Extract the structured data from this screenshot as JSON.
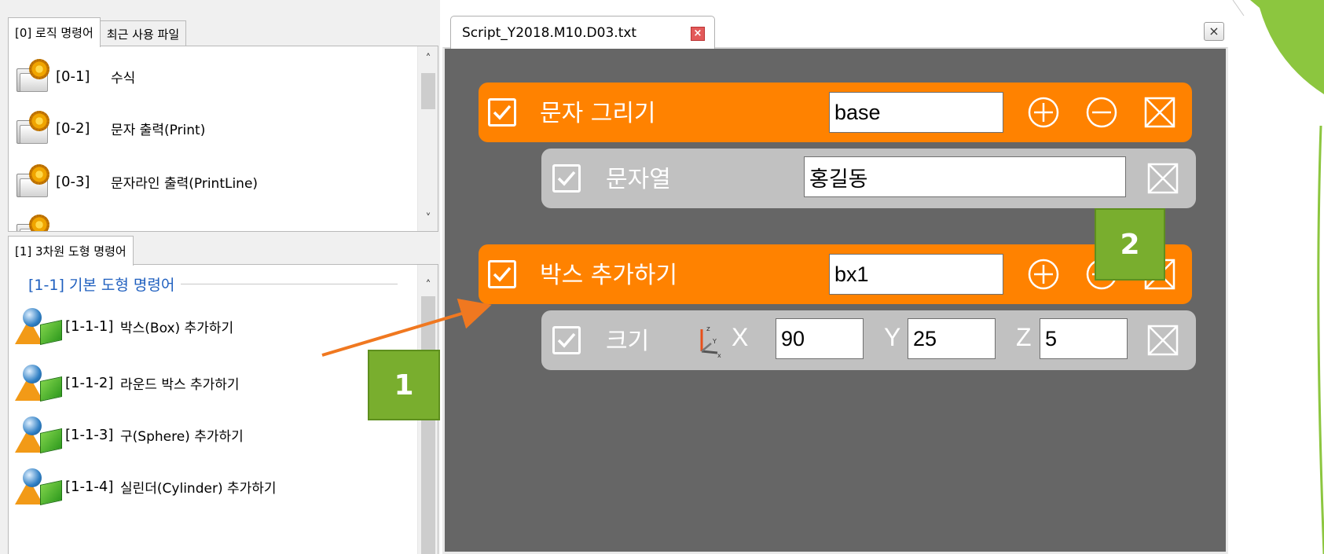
{
  "left_panel": {
    "top_tabs": [
      {
        "label": "[0] 로직 명령어",
        "active": true
      },
      {
        "label": "최근 사용 파일",
        "active": false
      }
    ],
    "logic_items": [
      {
        "code": "[0-1]",
        "label": "수식",
        "icon": "gear-folder-icon"
      },
      {
        "code": "[0-2]",
        "label": "문자 출력(Print)",
        "icon": "gear-folder-icon"
      },
      {
        "code": "[0-3]",
        "label": "문자라인 출력(PrintLine)",
        "icon": "gear-folder-icon"
      }
    ],
    "bottom_tabs": [
      {
        "label": "[1] 3차원 도형 명령어",
        "active": true
      }
    ],
    "section_header": "[1-1]  기본 도형 명령어",
    "shape_items": [
      {
        "code": "[1-1-1]",
        "label": "박스(Box) 추가하기",
        "icon": "shapes-icon"
      },
      {
        "code": "[1-1-2]",
        "label": "라운드 박스 추가하기",
        "icon": "shapes-icon"
      },
      {
        "code": "[1-1-3]",
        "label": "구(Sphere) 추가하기",
        "icon": "shapes-icon"
      },
      {
        "code": "[1-1-4]",
        "label": "실린더(Cylinder) 추가하기",
        "icon": "shapes-icon"
      }
    ]
  },
  "editor": {
    "tab_label": "Script_Y2018.M10.D03.txt",
    "window_close": "×",
    "blocks": [
      {
        "type": "command",
        "label": "문자 그리기",
        "value": "base",
        "checked": true,
        "color": "#ff8200"
      },
      {
        "type": "param",
        "label": "문자열",
        "value": "홍길동",
        "checked": true,
        "color": "#c1c1c1"
      },
      {
        "type": "command",
        "label": "박스 추가하기",
        "value": "bx1",
        "checked": true,
        "color": "#ff8200"
      },
      {
        "type": "param",
        "label": "크기",
        "checked": true,
        "color": "#c1c1c1",
        "x_label": "X",
        "x_value": "90",
        "y_label": "Y",
        "y_value": "25",
        "z_label": "Z",
        "z_value": "5"
      }
    ]
  },
  "annotations": {
    "callout_1": "1",
    "callout_2": "2",
    "callout_color": "#79ae2e",
    "arrow_color": "#f07820"
  }
}
